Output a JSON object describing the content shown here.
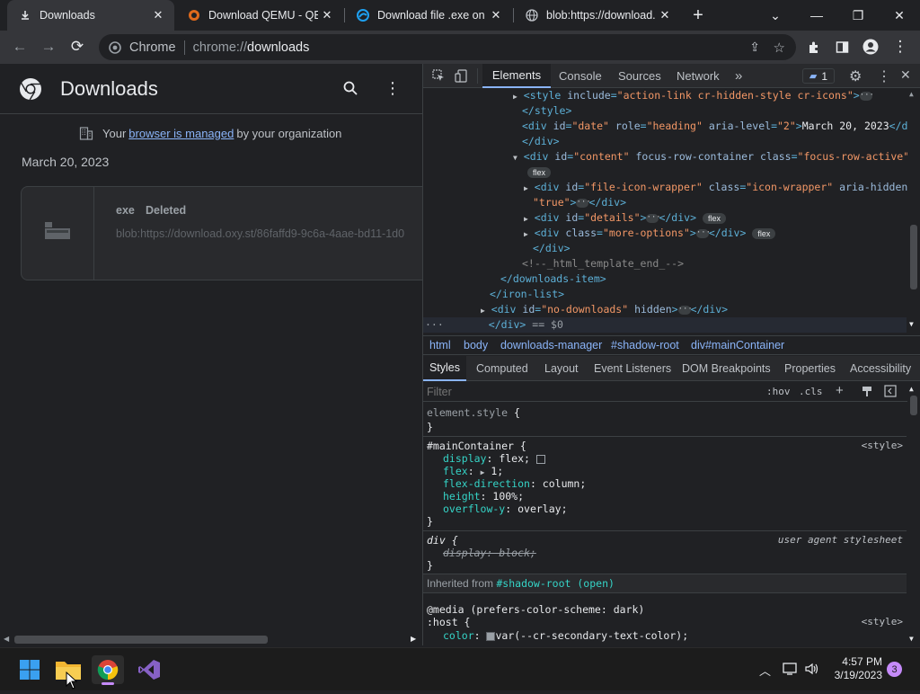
{
  "tabs": [
    {
      "title": "Downloads",
      "favicon": "download-icon",
      "active": true
    },
    {
      "title": "Download QEMU - QEM",
      "favicon": "qemu-icon"
    },
    {
      "title": "Download file .exe on O",
      "favicon": "site-icon"
    },
    {
      "title": "blob:https://download.",
      "favicon": "globe-icon"
    }
  ],
  "new_tab_label": "+",
  "omnibox": {
    "site_label": "Chrome",
    "url_prefix": "chrome://",
    "url_path": "downloads"
  },
  "downloads": {
    "title": "Downloads",
    "managed_prefix": "Your ",
    "managed_link": "browser is managed",
    "managed_suffix": " by your organization",
    "date": "March 20, 2023",
    "item": {
      "name": "exe",
      "status": "Deleted",
      "url": "blob:https://download.oxy.st/86faffd9-9c6a-4aae-bd11-1d0"
    }
  },
  "devtools": {
    "tabs": [
      "Elements",
      "Console",
      "Sources",
      "Network"
    ],
    "more": "»",
    "issues_count": "1",
    "elements_lines": [
      {
        "indent": 9,
        "tri": "▶",
        "html": "style"
      },
      {
        "indent": 9,
        "tri": "",
        "html": "style-close"
      },
      {
        "indent": 9,
        "tri": "",
        "html": "date"
      },
      {
        "indent": 9,
        "tri": "",
        "html": "div-close"
      },
      {
        "indent": 9,
        "tri": "▼",
        "html": "content"
      }
    ],
    "date_text": "March 20, 2023",
    "template_comment": "<!--_html_template_end_-->",
    "dollar0": "== $0",
    "breadcrumbs": [
      "html",
      "body",
      "downloads-manager",
      "#shadow-root",
      "div#mainContainer"
    ],
    "subtabs": [
      "Styles",
      "Computed",
      "Layout",
      "Event Listeners",
      "DOM Breakpoints",
      "Properties",
      "Accessibility"
    ],
    "filter_placeholder": "Filter",
    "hov": ":hov",
    "cls": ".cls",
    "styles": {
      "element_style": "element.style {",
      "main_selector": "#mainContainer {",
      "style_src": "<style>",
      "props": [
        {
          "name": "display",
          "value": "flex;"
        },
        {
          "name": "flex",
          "value": "1;"
        },
        {
          "name": "flex-direction",
          "value": "column;"
        },
        {
          "name": "height",
          "value": "100%;"
        },
        {
          "name": "overflow-y",
          "value": "overlay;"
        }
      ],
      "div_selector": "div {",
      "ua_src": "user agent stylesheet",
      "div_prop": "display: block;",
      "inherited_label": "Inherited from ",
      "inherited_link": "#shadow-root (open)",
      "media": "@media (prefers-color-scheme: dark)",
      "host_selector": ":host {",
      "color_name": "color",
      "color_value": "var(--cr-secondary-text-color);"
    }
  },
  "taskbar": {
    "time": "4:57 PM",
    "date": "3/19/2023",
    "notifications": "3"
  }
}
